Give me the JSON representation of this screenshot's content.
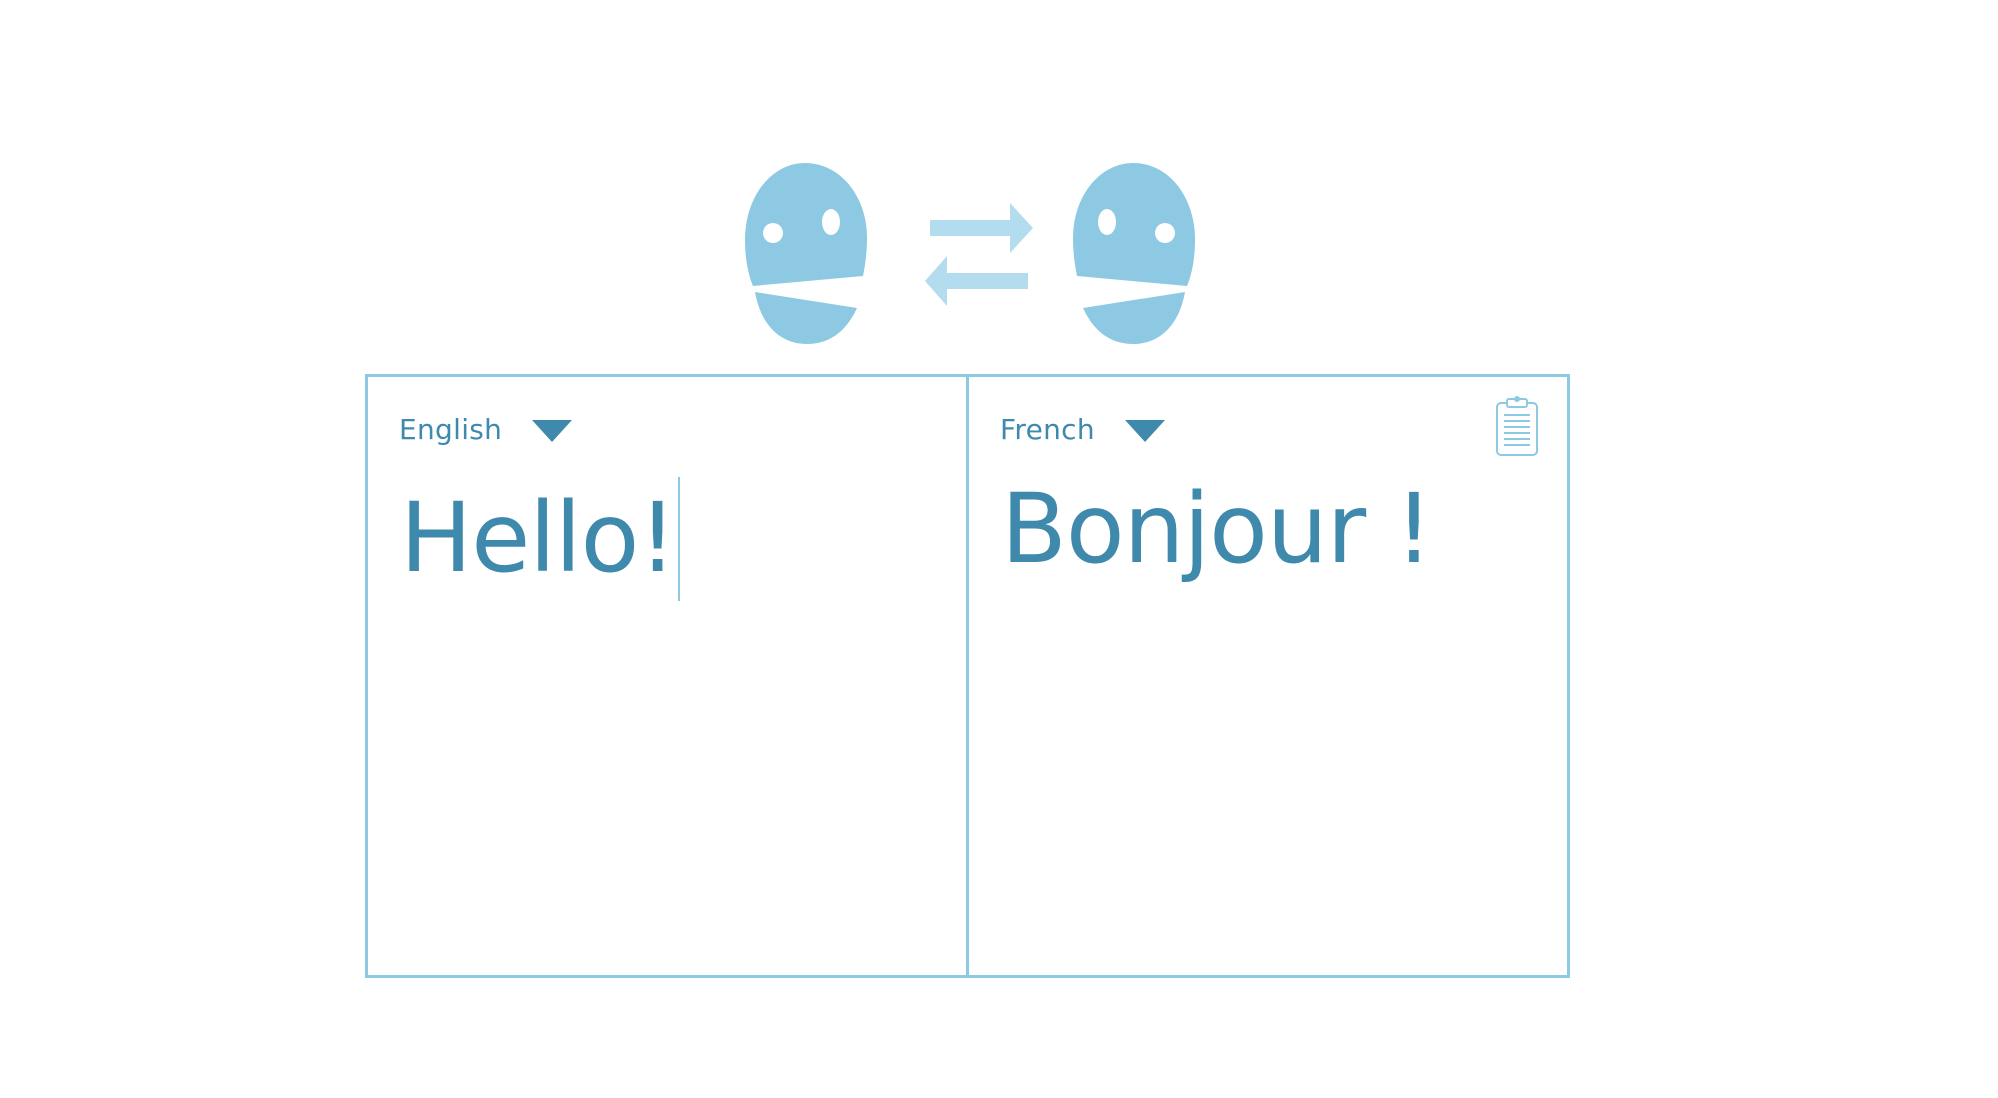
{
  "colors": {
    "accent": "#8dc9e2",
    "text": "#3f89ac",
    "arrows": "#b3dcef",
    "background": "#ffffff"
  },
  "logo": {
    "left_face_icon": "face-icon",
    "swap_icon": "swap-arrows-icon",
    "right_face_icon": "face-icon"
  },
  "source": {
    "language": "English",
    "text": "Hello!"
  },
  "target": {
    "language": "French",
    "text": "Bonjour !",
    "copy_icon": "clipboard-icon"
  }
}
